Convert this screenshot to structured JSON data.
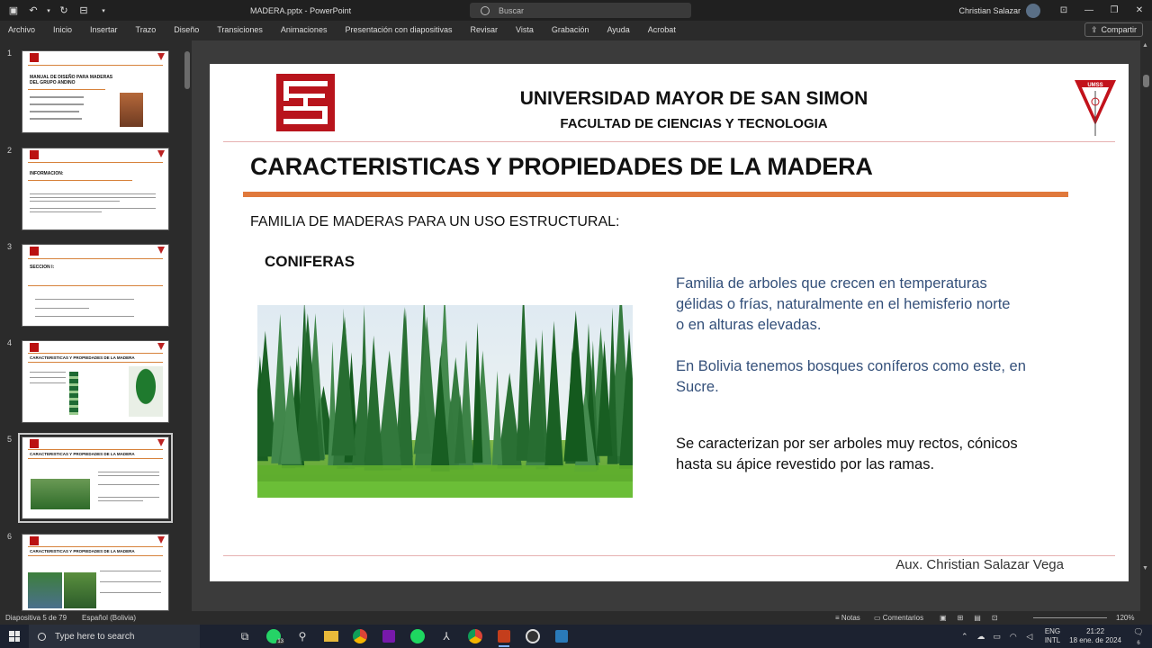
{
  "window": {
    "file_name": "MADERA.pptx",
    "separator": "-",
    "app_name": "PowerPoint",
    "search_placeholder": "Buscar",
    "user_name": "Christian Salazar"
  },
  "menu": [
    "Archivo",
    "Inicio",
    "Insertar",
    "Trazo",
    "Diseño",
    "Transiciones",
    "Animaciones",
    "Presentación con diapositivas",
    "Revisar",
    "Vista",
    "Grabación",
    "Ayuda",
    "Acrobat"
  ],
  "share_label": "Compartir",
  "thumbnails": [
    {
      "num": "1",
      "title": "MANUAL DE DISEÑO PARA MADERAS DEL GRUPO ANDINO"
    },
    {
      "num": "2",
      "title": "INFORMACION:"
    },
    {
      "num": "3",
      "title": "SECCION I:"
    },
    {
      "num": "4",
      "title": "CARACTERISTICAS Y PROPIEDADES DE LA MADERA"
    },
    {
      "num": "5",
      "title": "CARACTERISTICAS Y PROPIEDADES DE LA MADERA"
    },
    {
      "num": "6",
      "title": "CARACTERISTICAS Y PROPIEDADES DE LA MADERA"
    }
  ],
  "slide": {
    "university": "UNIVERSIDAD MAYOR DE SAN SIMON",
    "faculty": "FACULTAD DE CIENCIAS Y TECNOLOGIA",
    "title": "CARACTERISTICAS Y PROPIEDADES DE LA MADERA",
    "subtitle": "FAMILIA DE MADERAS PARA UN USO ESTRUCTURAL:",
    "section": "CONIFERAS",
    "para1_l1": "Familia de arboles que crecen en temperaturas",
    "para1_l2": "gélidas o frías, naturalmente en el hemisferio norte",
    "para1_l3": "o en alturas elevadas.",
    "para2_l1": "En Bolivia tenemos bosques coníferos como este, en",
    "para2_l2": "Sucre.",
    "para3_l1": "Se caracterizan por ser arboles muy rectos, cónicos",
    "para3_l2": "hasta su ápice revestido por las ramas.",
    "author": "Aux. Christian Salazar Vega",
    "umss_logo_text": "UMSS"
  },
  "status": {
    "slide_counter": "Diapositiva 5 de 79",
    "language": "Español (Bolivia)",
    "notes": "Notas",
    "comments": "Comentarios",
    "zoom": "120%"
  },
  "taskbar": {
    "search_placeholder": "Type here to search",
    "lang_line1": "ENG",
    "lang_line2": "INTL",
    "time": "21:22",
    "date": "18 ene. de 2024",
    "badge": "13",
    "notif_count": "6"
  }
}
